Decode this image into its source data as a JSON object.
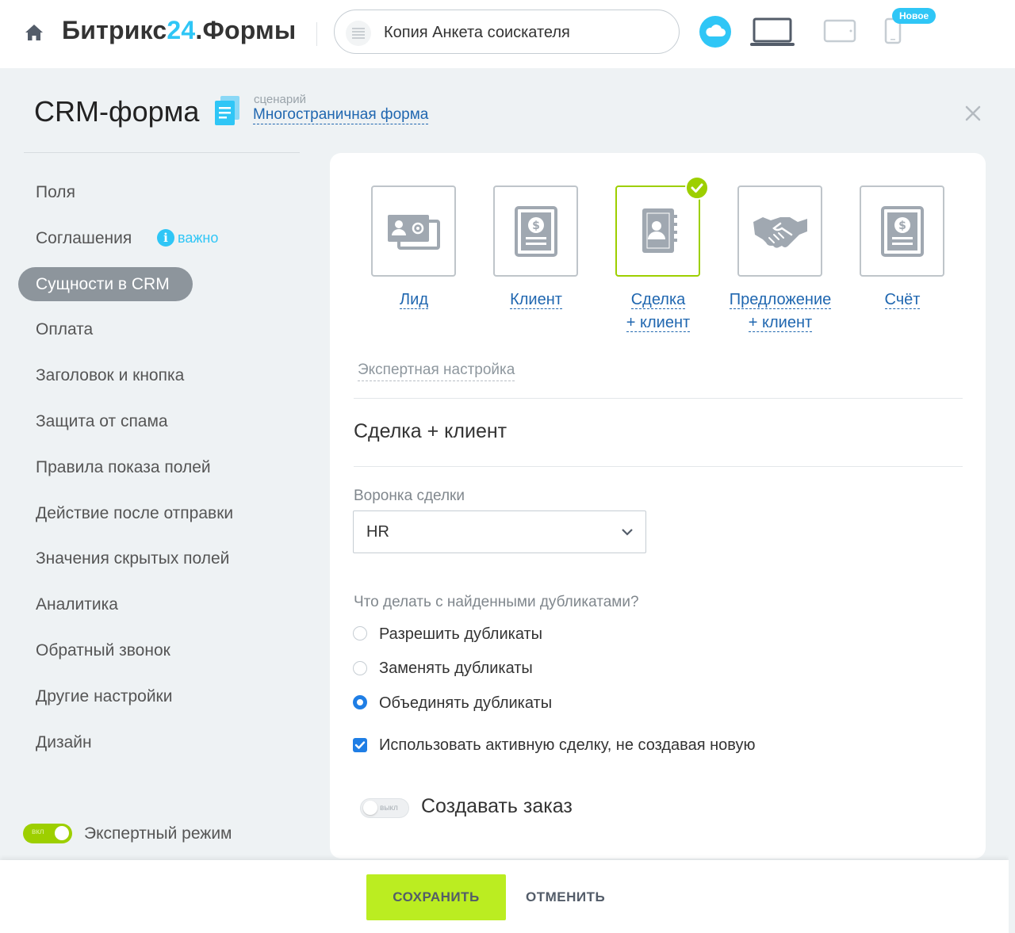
{
  "header": {
    "brand_prefix": "Битрикс",
    "brand_number": "24",
    "brand_suffix": ".Формы",
    "form_name": "Копия Анкета соискателя",
    "new_badge": "Новое"
  },
  "title": {
    "main": "CRM-форма",
    "scenario_caption": "сценарий",
    "scenario_value": "Многостраничная форма"
  },
  "sidebar": {
    "items": [
      {
        "label": "Поля"
      },
      {
        "label": "Соглашения"
      },
      {
        "label": "Сущности в CRM"
      },
      {
        "label": "Оплата"
      },
      {
        "label": "Заголовок и кнопка"
      },
      {
        "label": "Защита от спама"
      },
      {
        "label": "Правила показа полей"
      },
      {
        "label": "Действие после отправки"
      },
      {
        "label": "Значения скрытых полей"
      },
      {
        "label": "Аналитика"
      },
      {
        "label": "Обратный звонок"
      },
      {
        "label": "Другие настройки"
      },
      {
        "label": "Дизайн"
      }
    ],
    "important_label": "важно",
    "info_glyph": "i",
    "expert_toggle_state": "вкл",
    "expert_label": "Экспертный режим"
  },
  "entities": [
    {
      "line1": "Лид",
      "line2": "",
      "icon": "lead-icon"
    },
    {
      "line1": "Клиент",
      "line2": "",
      "icon": "invoice-doc-icon"
    },
    {
      "line1": "Сделка",
      "line2": "+ клиент",
      "icon": "contact-book-icon",
      "selected": true
    },
    {
      "line1": "Предложение",
      "line2": "+ клиент",
      "icon": "handshake-icon"
    },
    {
      "line1": "Счёт",
      "line2": "",
      "icon": "invoice-doc-icon"
    }
  ],
  "main": {
    "expert_setting": "Экспертная настройка",
    "section_title": "Сделка + клиент",
    "pipeline_label": "Воронка сделки",
    "pipeline_value": "HR",
    "duplicates_question": "Что делать с найденными дубликатами?",
    "duplicate_options": [
      {
        "label": "Разрешить дубликаты",
        "selected": false
      },
      {
        "label": "Заменять дубликаты",
        "selected": false
      },
      {
        "label": "Объединять дубликаты",
        "selected": true
      }
    ],
    "active_deal_label": "Использовать активную сделку, не создавая новую",
    "active_deal_checked": true,
    "order_toggle_state": "выкл",
    "order_label": "Создавать заказ"
  },
  "footer": {
    "save": "СОХРАНИТЬ",
    "cancel": "ОТМЕНИТЬ"
  },
  "colors": {
    "accent_blue": "#2fc6f6",
    "link_blue": "#2067b0",
    "selected_green": "#9dcf00",
    "save_green": "#bbed21",
    "radio_blue": "#1f7ee5"
  }
}
